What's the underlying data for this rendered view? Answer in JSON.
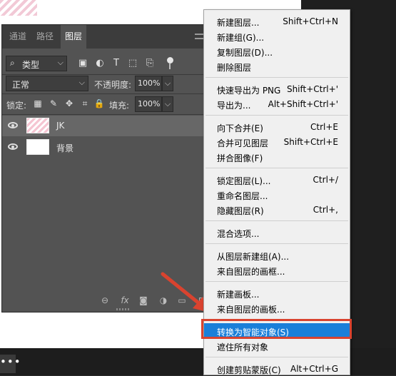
{
  "panel": {
    "tabs": [
      {
        "label": "通道",
        "active": false
      },
      {
        "label": "路径",
        "active": false
      },
      {
        "label": "图层",
        "active": true
      }
    ],
    "filter": {
      "label": "类型"
    },
    "blend_mode": "正常",
    "opacity": {
      "label": "不透明度:",
      "value": "100%"
    },
    "lock_label": "锁定:",
    "fill": {
      "label": "填充:",
      "value": "100%"
    },
    "layers": [
      {
        "name": "JK",
        "visible": true,
        "selected": true
      },
      {
        "name": "背景",
        "visible": true,
        "selected": false
      }
    ],
    "bottom_icons": [
      "link-icon",
      "fx-icon",
      "mask-icon",
      "adjustment-icon",
      "folder-icon",
      "new-layer-icon"
    ]
  },
  "status": {
    "menu_glyph": "•••"
  },
  "context_menu": {
    "groups": [
      [
        {
          "label": "新建图层...",
          "shortcut": "Shift+Ctrl+N"
        },
        {
          "label": "新建组(G)...",
          "shortcut": ""
        },
        {
          "label": "复制图层(D)...",
          "shortcut": ""
        },
        {
          "label": "删除图层",
          "shortcut": ""
        }
      ],
      [
        {
          "label": "快速导出为 PNG",
          "shortcut": "Shift+Ctrl+'"
        },
        {
          "label": "导出为...",
          "shortcut": "Alt+Shift+Ctrl+'"
        }
      ],
      [
        {
          "label": "向下合并(E)",
          "shortcut": "Ctrl+E"
        },
        {
          "label": "合并可见图层",
          "shortcut": "Shift+Ctrl+E"
        },
        {
          "label": "拼合图像(F)",
          "shortcut": ""
        }
      ],
      [
        {
          "label": "锁定图层(L)...",
          "shortcut": "Ctrl+/"
        },
        {
          "label": "重命名图层...",
          "shortcut": ""
        },
        {
          "label": "隐藏图层(R)",
          "shortcut": "Ctrl+,"
        }
      ],
      [
        {
          "label": "混合选项...",
          "shortcut": ""
        }
      ],
      [
        {
          "label": "从图层新建组(A)...",
          "shortcut": ""
        },
        {
          "label": "来自图层的画框...",
          "shortcut": ""
        }
      ],
      [
        {
          "label": "新建画板...",
          "shortcut": ""
        },
        {
          "label": "来自图层的画板...",
          "shortcut": ""
        }
      ],
      [
        {
          "label": "转换为智能对象(S)",
          "shortcut": "",
          "highlighted": true
        },
        {
          "label": "遮住所有对象",
          "shortcut": ""
        }
      ],
      [
        {
          "label": "创建剪贴蒙版(C)",
          "shortcut": "Alt+Ctrl+G"
        }
      ]
    ]
  },
  "colors": {
    "panel_bg": "#535353",
    "menu_bg": "#f0f0f0",
    "menu_highlight": "#1a7fd9",
    "annotation_red": "#d9432f"
  }
}
